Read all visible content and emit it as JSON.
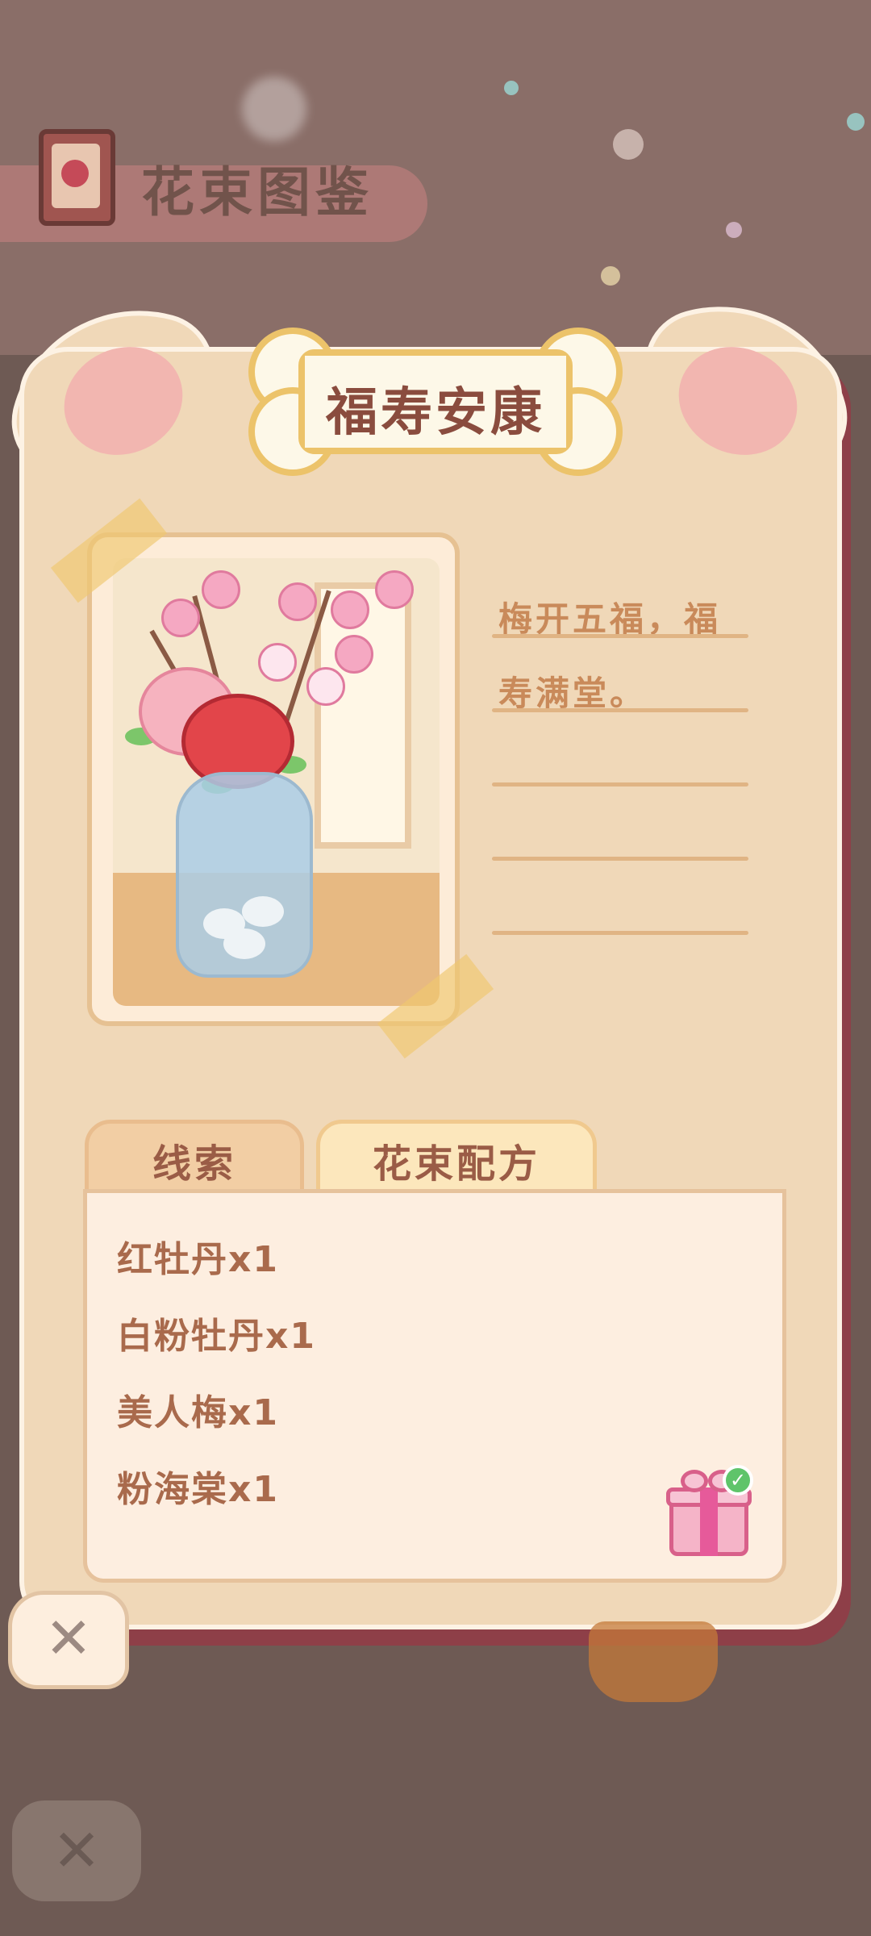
{
  "header": {
    "title": "花束图鉴",
    "book_icon": "flower-book-icon"
  },
  "card": {
    "title": "福寿安康",
    "description": "梅开五福，福寿满堂。"
  },
  "tabs": [
    {
      "label": "线索",
      "active": false
    },
    {
      "label": "花束配方",
      "active": true
    }
  ],
  "recipe": {
    "items": [
      "红牡丹x1",
      "白粉牡丹x1",
      "美人梅x1",
      "粉海棠x1"
    ],
    "reward_icon": "gift-box-icon",
    "reward_claimed": true
  },
  "buttons": {
    "close_label": "✕",
    "background_close_label": "✕"
  },
  "colors": {
    "card_bg": "#f0d8b8",
    "card_shadow": "#8e3f48",
    "title_text": "#8a4c3e",
    "recipe_text": "#a96a4c",
    "bone_border": "#ecc36a"
  }
}
